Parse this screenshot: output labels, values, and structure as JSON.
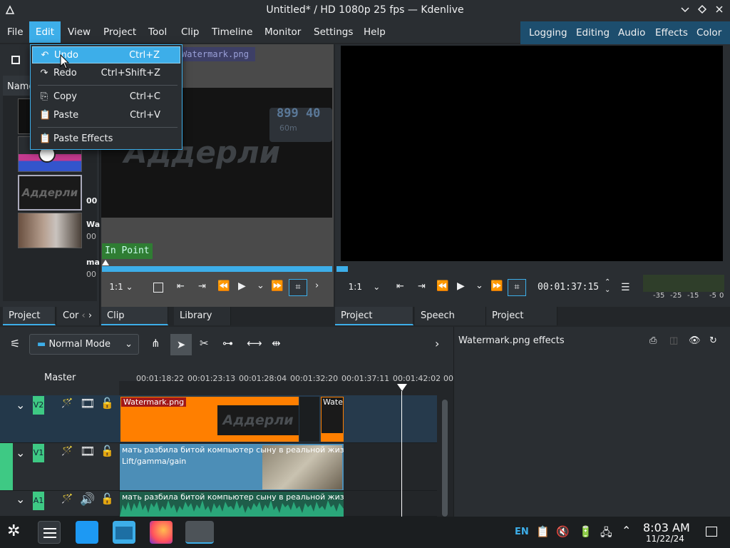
{
  "window": {
    "title": "Untitled* / HD 1080p 25 fps — Kdenlive",
    "min_icon": "chevron-down-icon",
    "max_icon": "diamond-icon",
    "close_icon": "close-icon"
  },
  "menubar": {
    "items": [
      "File",
      "Edit",
      "View",
      "Project",
      "Tool",
      "Clip",
      "Timeline",
      "Monitor",
      "Settings",
      "Help"
    ],
    "active": "Edit"
  },
  "layouts": [
    "Logging",
    "Editing",
    "Audio",
    "Effects",
    "Color"
  ],
  "edit_menu": {
    "items": [
      {
        "label": "Undo",
        "shortcut": "Ctrl+Z",
        "icon": "undo-icon"
      },
      {
        "label": "Redo",
        "shortcut": "Ctrl+Shift+Z",
        "icon": "redo-icon"
      },
      {
        "label": "Copy",
        "shortcut": "Ctrl+C",
        "icon": "copy-icon"
      },
      {
        "label": "Paste",
        "shortcut": "Ctrl+V",
        "icon": "paste-icon"
      },
      {
        "label": "Paste Effects",
        "shortcut": "",
        "icon": "paste-effects-icon"
      }
    ]
  },
  "bin": {
    "column_name": "Name",
    "clips": [
      {
        "label": "",
        "sub": ""
      },
      {
        "label": "",
        "sub": "00"
      },
      {
        "label": "Wa",
        "sub": "00"
      },
      {
        "label": "ma",
        "sub": "00"
      }
    ],
    "thumb_text": "Аддерли"
  },
  "clip_monitor": {
    "clip_name": "Watermark.png",
    "in_point_label": "In Point",
    "overlay_big": "Аддерли",
    "overlay_small": "899 40",
    "overlay_sub": "60m",
    "zoom": "1:1"
  },
  "project_monitor": {
    "zoom": "1:1",
    "timecode": "00:01:37:15",
    "audio_scale": [
      "-35",
      "-25",
      "-15",
      "-5",
      "0"
    ]
  },
  "tabs": {
    "left": [
      "Project ...",
      "Cor"
    ],
    "middle": [
      "Clip Monitor",
      "Library"
    ],
    "right": [
      "Project Monitor",
      "Speech Editor",
      "Project Notes"
    ]
  },
  "timeline_toolbar": {
    "mode": "Normal Mode"
  },
  "effects_panel": {
    "title": "Watermark.png effects"
  },
  "timeline": {
    "master_label": "Master",
    "ruler_ticks": [
      "00:01:18:22",
      "00:01:23:13",
      "00:01:28:04",
      "00:01:32:20",
      "00:01:37:11",
      "00:01:42:02",
      "00"
    ],
    "tracks": [
      {
        "name": "V2",
        "kind": "video"
      },
      {
        "name": "V1",
        "kind": "video"
      },
      {
        "name": "A1",
        "kind": "audio"
      }
    ],
    "clips": {
      "v2_a": "Watermark.png",
      "v2_b": "Wate",
      "v2_thumb": "Аддерли",
      "v1_title": "мать разбила битой компьютер сыну в реальной жизни",
      "v1_effect": "Lift/gamma/gain",
      "a1_title": "мать разбила битой компьютер сыну в реальной жизни"
    }
  },
  "taskbar": {
    "lang": "EN",
    "time": "8:03 AM",
    "date": "11/22/24"
  },
  "colors": {
    "accent": "#3daee9",
    "clip_orange": "#ff7f00",
    "clip_blue": "#4c8eb7",
    "audio_green": "#2aa77a",
    "track_green": "#3ec984"
  }
}
